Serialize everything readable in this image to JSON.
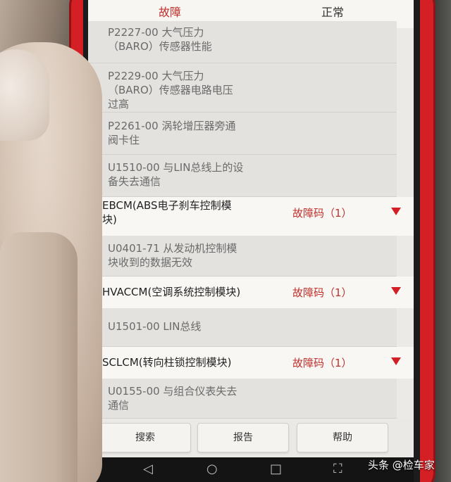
{
  "tabs": {
    "fault": "故障",
    "normal": "正常"
  },
  "items": [
    {
      "lines": [
        "P2227-00 大气压力",
        "（BARO）传感器性能"
      ]
    },
    {
      "lines": [
        "P2229-00 大气压力",
        "（BARO）传感器电路电压",
        "过高"
      ]
    },
    {
      "lines": [
        "P2261-00 涡轮增压器旁通",
        "阀卡住"
      ]
    },
    {
      "lines": [
        "U1510-00 与LIN总线上的设",
        "备失去通信"
      ]
    }
  ],
  "modules": [
    {
      "name": [
        "EBCM(ABS电子刹车控制模",
        "块)"
      ],
      "count": "故障码（1）",
      "codes": [
        [
          "U0401-71 从发动机控制模",
          "块收到的数据无效"
        ]
      ]
    },
    {
      "name": [
        "HVACCM(空调系统控制模块)"
      ],
      "count": "故障码（1）",
      "codes": [
        [
          "U1501-00 LIN总线"
        ]
      ]
    },
    {
      "name": [
        "SCLCM(转向柱锁控制模块)"
      ],
      "count": "故障码（1）",
      "codes": [
        [
          "U0155-00 与组合仪表失去",
          "通信"
        ]
      ]
    }
  ],
  "buttons": {
    "search": "搜索",
    "report": "报告",
    "help": "帮助"
  },
  "nav": {
    "back": "◁",
    "home": "○",
    "recent": "□",
    "screenshot": "⛶"
  },
  "watermark": "头条 @检车家",
  "colors": {
    "accent": "#c0302c",
    "frame": "#d41f24"
  }
}
